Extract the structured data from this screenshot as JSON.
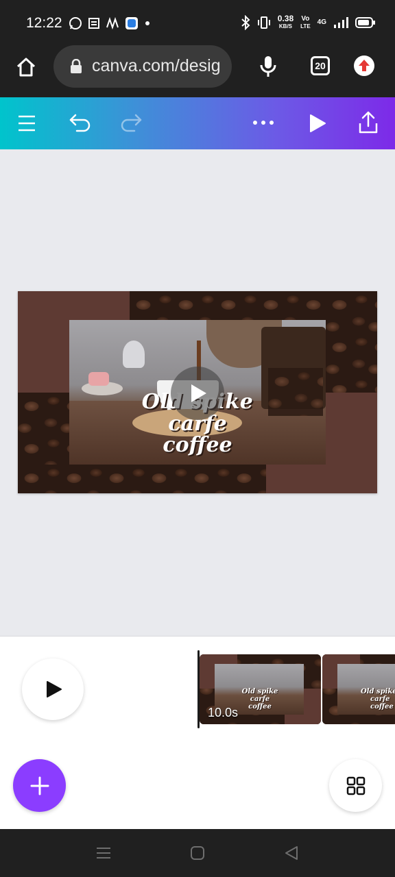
{
  "status_bar": {
    "time": "12:22",
    "net_speed_value": "0.38",
    "net_speed_unit": "KB/S",
    "volte_top": "Vo",
    "volte_bottom": "LTE",
    "network": "4G"
  },
  "browser": {
    "url": "canva.com/desig",
    "tab_count": "20"
  },
  "design": {
    "title_line1": "Old spike",
    "title_line2": "carfe",
    "title_line3": "coffee"
  },
  "timeline": {
    "clips": [
      {
        "duration": "10.0s",
        "title_line1": "Old spike",
        "title_line2": "carfe",
        "title_line3": "coffee"
      },
      {
        "duration": "",
        "title_line1": "Old spike",
        "title_line2": "carfe",
        "title_line3": "coffee"
      }
    ]
  },
  "icons": {
    "home": "home-icon",
    "lock": "lock-icon",
    "mic": "microphone-icon",
    "update": "update-icon",
    "menu": "menu-icon",
    "undo": "undo-icon",
    "redo": "redo-icon",
    "more": "more-icon",
    "play": "play-icon",
    "share": "share-icon",
    "add": "plus-icon",
    "grid": "grid-icon"
  },
  "colors": {
    "toolbar_start": "#00c4cc",
    "toolbar_end": "#7d2ae8",
    "add_button": "#8b3dff",
    "design_bg": "#5e3a33"
  }
}
